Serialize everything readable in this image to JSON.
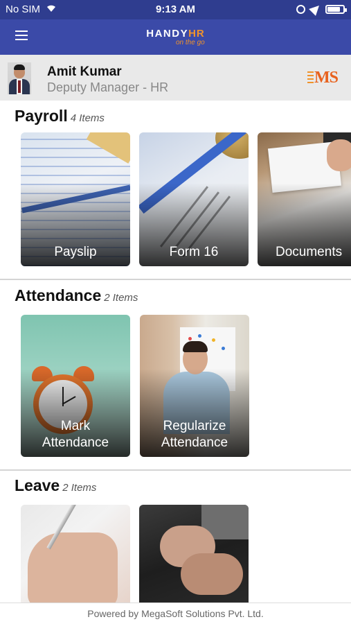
{
  "status_bar": {
    "carrier": "No SIM",
    "time": "9:13 AM"
  },
  "app_bar": {
    "brand_primary": "HANDY",
    "brand_accent": "HR",
    "brand_tagline": "on the go",
    "menu_icon": "hamburger-menu-icon",
    "colors": {
      "bar": "#3b4aa8",
      "status": "#2f3d8f",
      "accent": "#f0932b"
    }
  },
  "profile": {
    "name": "Amit Kumar",
    "role": "Deputy Manager - HR",
    "company_logo_text": "MS"
  },
  "sections": {
    "payroll": {
      "title": "Payroll",
      "count": "4 Items",
      "cards": [
        {
          "label": "Payslip"
        },
        {
          "label": "Form 16"
        },
        {
          "label": "Documents"
        }
      ]
    },
    "attendance": {
      "title": "Attendance",
      "count": "2 Items",
      "cards": [
        {
          "label": "Mark\nAttendance"
        },
        {
          "label": "Regularize\nAttendance"
        }
      ]
    },
    "leave": {
      "title": "Leave",
      "count": "2 Items",
      "cards": [
        {
          "label": ""
        },
        {
          "label": ""
        }
      ]
    }
  },
  "footer": {
    "text": "Powered by MegaSoft Solutions Pvt. Ltd."
  }
}
